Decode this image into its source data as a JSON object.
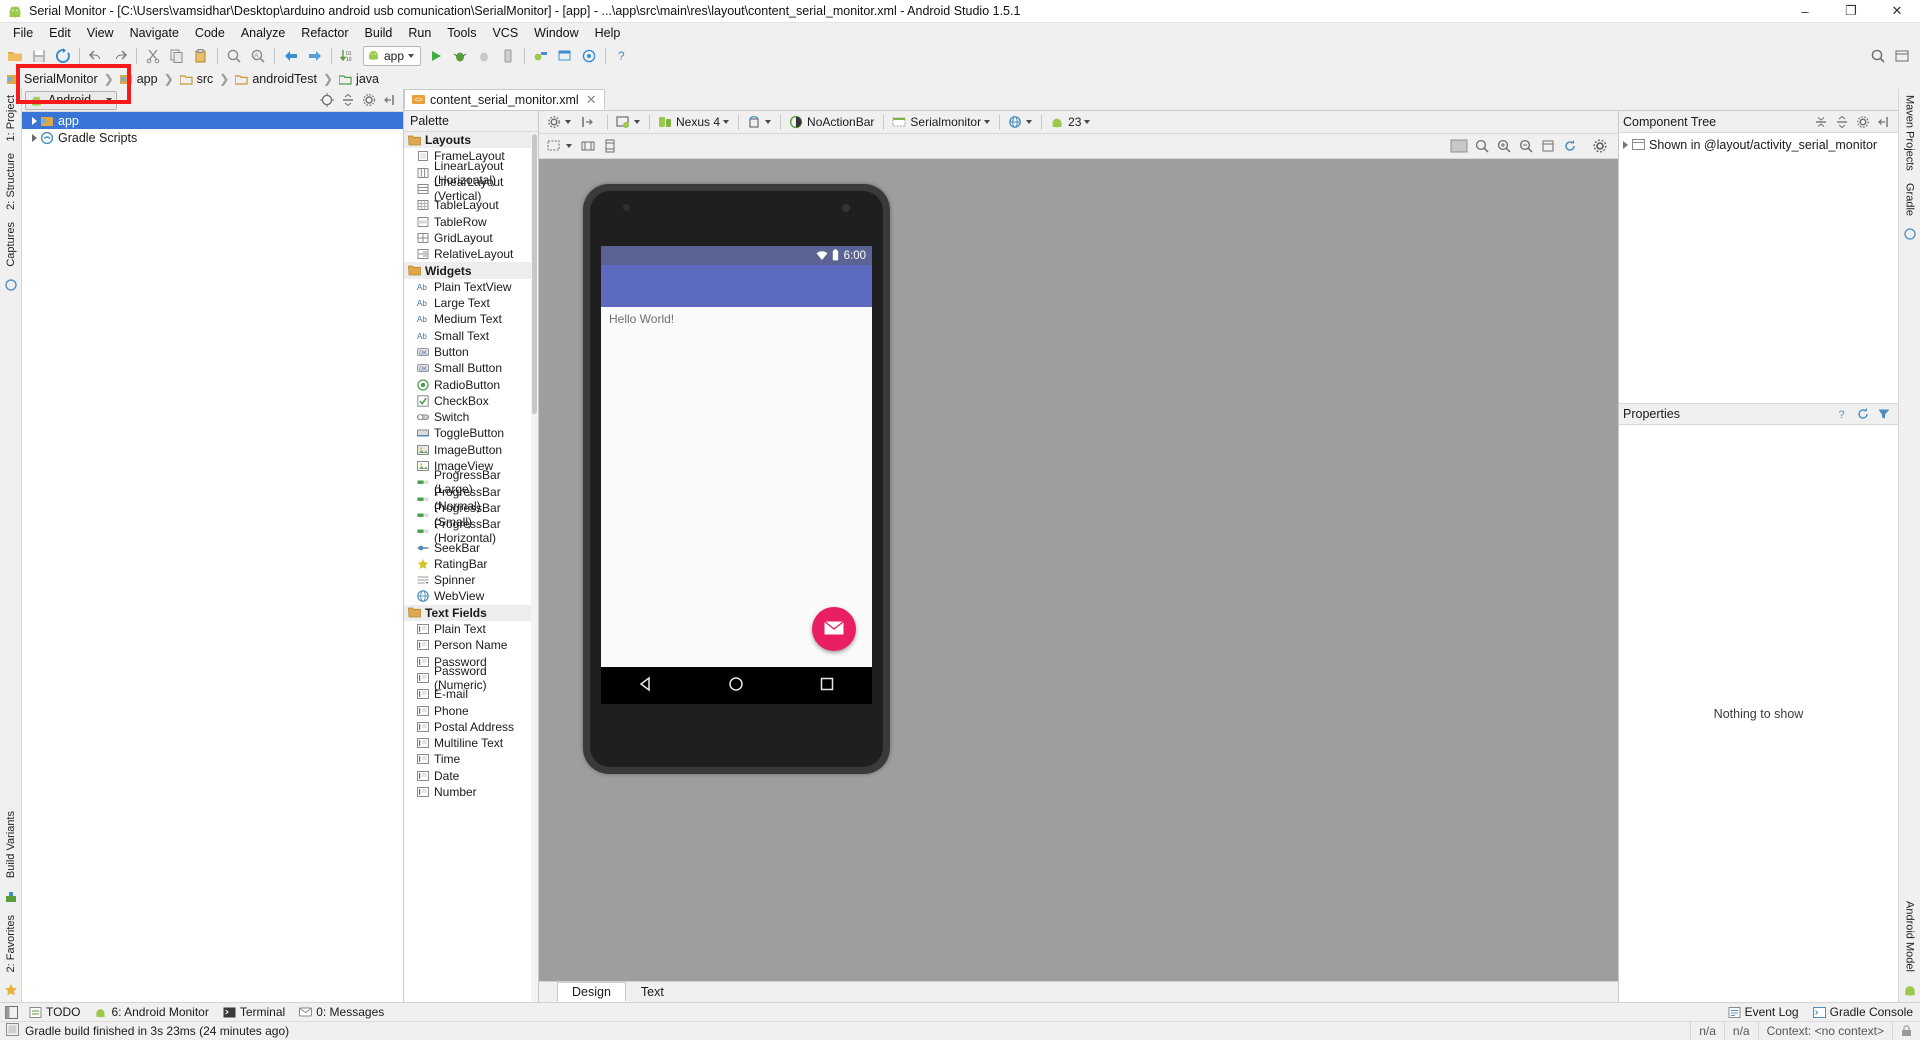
{
  "window": {
    "title": "Serial Monitor - [C:\\Users\\vamsidhar\\Desktop\\arduino android usb comunication\\SerialMonitor] - [app] - ...\\app\\src\\main\\res\\layout\\content_serial_monitor.xml - Android Studio 1.5.1",
    "icon": "android-icon",
    "minimize": "–",
    "maximize": "❐",
    "close": "✕"
  },
  "menu": {
    "items": [
      {
        "label": "File"
      },
      {
        "label": "Edit"
      },
      {
        "label": "View"
      },
      {
        "label": "Navigate"
      },
      {
        "label": "Code"
      },
      {
        "label": "Analyze"
      },
      {
        "label": "Refactor"
      },
      {
        "label": "Build"
      },
      {
        "label": "Run"
      },
      {
        "label": "Tools"
      },
      {
        "label": "VCS"
      },
      {
        "label": "Window"
      },
      {
        "label": "Help"
      }
    ]
  },
  "toolbar": {
    "run_config": "app",
    "icons": [
      "open-folder-icon",
      "save-all-icon",
      "sync-icon",
      "undo-icon",
      "redo-icon",
      "cut-icon",
      "copy-icon",
      "paste-icon",
      "find-icon",
      "replace-icon",
      "back-icon",
      "forward-icon",
      "compile-icon"
    ],
    "right_icons": [
      "search-everywhere-icon",
      "layout-icon"
    ]
  },
  "breadcrumb": {
    "items": [
      {
        "label": "SerialMonitor",
        "icon": "module-icon"
      },
      {
        "label": "app",
        "icon": "module-icon"
      },
      {
        "label": "src",
        "icon": "folder-icon"
      },
      {
        "label": "androidTest",
        "icon": "folder-icon"
      },
      {
        "label": "java",
        "icon": "source-folder-icon"
      }
    ],
    "separator": "❯"
  },
  "project_panel": {
    "view_selector": "Android",
    "header_icons": [
      "target-icon",
      "collapse-all-icon",
      "settings-icon",
      "hide-icon"
    ],
    "tree": [
      {
        "label": "app",
        "icon": "module-icon",
        "selected": true,
        "expandable": true,
        "indent": 0
      },
      {
        "label": "Gradle Scripts",
        "icon": "gradle-icon",
        "selected": false,
        "expandable": true,
        "indent": 0
      }
    ]
  },
  "left_strips": {
    "top": [
      "1: Project"
    ],
    "items": [
      "2: Structure",
      "Captures"
    ],
    "bottom": [
      "Build Variants",
      "2: Favorites"
    ]
  },
  "right_strips": {
    "items": [
      "Maven Projects",
      "Gradle",
      "Android Model"
    ]
  },
  "editor": {
    "tabs": [
      {
        "label": "content_serial_monitor.xml",
        "icon": "xml-file-icon",
        "active": true,
        "close": "✕"
      }
    ]
  },
  "palette": {
    "title": "Palette",
    "groups": [
      {
        "name": "Layouts",
        "items": [
          {
            "label": "FrameLayout",
            "icon": "framelayout-icon"
          },
          {
            "label": "LinearLayout (Horizontal)",
            "icon": "linearlayout-h-icon"
          },
          {
            "label": "LinearLayout (Vertical)",
            "icon": "linearlayout-v-icon"
          },
          {
            "label": "TableLayout",
            "icon": "tablelayout-icon"
          },
          {
            "label": "TableRow",
            "icon": "tablerow-icon"
          },
          {
            "label": "GridLayout",
            "icon": "gridlayout-icon"
          },
          {
            "label": "RelativeLayout",
            "icon": "relativelayout-icon"
          }
        ]
      },
      {
        "name": "Widgets",
        "items": [
          {
            "label": "Plain TextView",
            "icon": "textview-icon"
          },
          {
            "label": "Large Text",
            "icon": "textview-icon"
          },
          {
            "label": "Medium Text",
            "icon": "textview-icon"
          },
          {
            "label": "Small Text",
            "icon": "textview-icon"
          },
          {
            "label": "Button",
            "icon": "button-icon"
          },
          {
            "label": "Small Button",
            "icon": "button-icon"
          },
          {
            "label": "RadioButton",
            "icon": "radiobutton-icon"
          },
          {
            "label": "CheckBox",
            "icon": "checkbox-icon"
          },
          {
            "label": "Switch",
            "icon": "switch-icon"
          },
          {
            "label": "ToggleButton",
            "icon": "togglebutton-icon"
          },
          {
            "label": "ImageButton",
            "icon": "imagebutton-icon"
          },
          {
            "label": "ImageView",
            "icon": "imageview-icon"
          },
          {
            "label": "ProgressBar (Large)",
            "icon": "progressbar-icon"
          },
          {
            "label": "ProgressBar (Normal)",
            "icon": "progressbar-icon"
          },
          {
            "label": "ProgressBar (Small)",
            "icon": "progressbar-icon"
          },
          {
            "label": "ProgressBar (Horizontal)",
            "icon": "progressbar-icon"
          },
          {
            "label": "SeekBar",
            "icon": "seekbar-icon"
          },
          {
            "label": "RatingBar",
            "icon": "ratingbar-icon"
          },
          {
            "label": "Spinner",
            "icon": "spinner-icon"
          },
          {
            "label": "WebView",
            "icon": "webview-icon"
          }
        ]
      },
      {
        "name": "Text Fields",
        "items": [
          {
            "label": "Plain Text",
            "icon": "textfield-icon"
          },
          {
            "label": "Person Name",
            "icon": "textfield-icon"
          },
          {
            "label": "Password",
            "icon": "textfield-icon"
          },
          {
            "label": "Password (Numeric)",
            "icon": "textfield-icon"
          },
          {
            "label": "E-mail",
            "icon": "textfield-icon"
          },
          {
            "label": "Phone",
            "icon": "textfield-icon"
          },
          {
            "label": "Postal Address",
            "icon": "textfield-icon"
          },
          {
            "label": "Multiline Text",
            "icon": "textfield-icon"
          },
          {
            "label": "Time",
            "icon": "textfield-icon"
          },
          {
            "label": "Date",
            "icon": "textfield-icon"
          },
          {
            "label": "Number",
            "icon": "textfield-icon"
          }
        ]
      }
    ]
  },
  "config_bar": {
    "settings_icon": "gear-icon",
    "hide_icon": "hide-panel-icon",
    "items": [
      {
        "label": "",
        "icon": "android-version-icon",
        "has_caret": true
      },
      {
        "label": "Nexus 4",
        "icon": "device-icon",
        "has_caret": true
      },
      {
        "label": "",
        "icon": "orientation-icon",
        "has_caret": true
      },
      {
        "label": "NoActionBar",
        "icon": "theme-icon",
        "has_caret": true
      },
      {
        "label": "Serialmonitor",
        "icon": "activity-icon",
        "has_caret": true
      },
      {
        "label": "",
        "icon": "locale-icon",
        "has_caret": true
      },
      {
        "label": "23",
        "icon": "api-icon",
        "has_caret": true
      }
    ]
  },
  "view_bar": {
    "left_icons": [
      "select-mode-icon",
      "fit-width-icon",
      "fit-height-icon"
    ],
    "right_icons": [
      "render-mode-icon",
      "zoom-fit-icon",
      "zoom-in-icon",
      "zoom-out-icon",
      "zoom-actual-icon",
      "refresh-icon",
      "gear-icon"
    ]
  },
  "preview": {
    "device": "Nexus 4",
    "status_time": "6:00",
    "status_icons": [
      "wifi-icon",
      "battery-icon"
    ],
    "hello_text": "Hello World!",
    "fab_icon": "mail-icon",
    "nav_buttons": [
      "back-nav-icon",
      "home-nav-icon",
      "recents-nav-icon"
    ]
  },
  "component_tree": {
    "title": "Component Tree",
    "header_icons": [
      "expand-all-icon",
      "collapse-all-icon",
      "settings-icon",
      "hide-icon"
    ],
    "rows": [
      {
        "label": "Shown in @layout/activity_serial_monitor",
        "icon": "include-icon"
      }
    ]
  },
  "properties": {
    "title": "Properties",
    "header_icons": [
      "help-icon",
      "reset-icon",
      "filter-icon"
    ],
    "empty_text": "Nothing to show"
  },
  "design_tabs": [
    {
      "label": "Design",
      "active": true
    },
    {
      "label": "Text",
      "active": false
    }
  ],
  "bottom_bar": {
    "left_items": [
      {
        "label": "TODO",
        "icon": "todo-icon"
      },
      {
        "label": "6: Android Monitor",
        "icon": "android-monitor-icon"
      },
      {
        "label": "Terminal",
        "icon": "terminal-icon"
      },
      {
        "label": "0: Messages",
        "icon": "messages-icon"
      }
    ],
    "right_items": [
      {
        "label": "Event Log",
        "icon": "event-log-icon"
      },
      {
        "label": "Gradle Console",
        "icon": "gradle-console-icon"
      }
    ]
  },
  "status_line": {
    "message": "Gradle build finished in 3s 23ms (24 minutes ago)",
    "icon": "build-icon",
    "cells": [
      "n/a",
      "n/a",
      "Context: <no context>"
    ],
    "lock_icon": "lock-icon"
  },
  "annotation": {
    "highlight_label": "android-view-selector-highlight",
    "color": "#f61a1a"
  },
  "colors": {
    "accent_blue": "#3875d7",
    "appbar": "#5c6bc0",
    "statusbar": "#5a6393",
    "fab": "#e91e63",
    "canvas_bg": "#9e9e9e",
    "annotation_red": "#f61a1a"
  }
}
